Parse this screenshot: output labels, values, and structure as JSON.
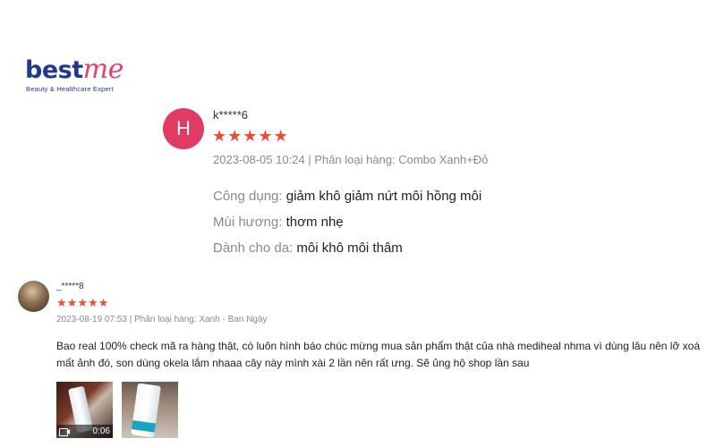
{
  "brand": {
    "name_part1": "best",
    "name_part2": "me",
    "tagline": "Beauty & Healthcare Expert",
    "primary_color": "#233a8c",
    "accent_color": "#e5406f"
  },
  "reviews": [
    {
      "avatar_initial": "H",
      "avatar_color": "#e23b63",
      "username": "k*****6",
      "rating": 5,
      "meta": "2023-08-05 10:24 | Phân loại hàng: Combo Xanh+Đỏ",
      "attributes": [
        {
          "label": "Công dụng:",
          "value": "giảm khô giảm nứt môi hồng môi"
        },
        {
          "label": "Mùi hương:",
          "value": "thơm nhẹ"
        },
        {
          "label": "Dành cho da:",
          "value": "môi khô môi thâm"
        }
      ]
    },
    {
      "avatar_icon": "user-photo",
      "username": "_*****8",
      "rating": 5,
      "meta": "2023-08-19 07:53 | Phân loại hàng: Xanh - Ban Ngày",
      "text": "Bao real 100% check mã ra hàng thật, có luôn hình báo chúc mừng mua sản phẩm thật của nhà mediheal nhma vì dùng lâu nên lỡ xoá mất ảnh đó, son dùng okela lắm nhaaa cây này mình xài 2 lần nên rất ưng. Sẽ ủng hộ shop lần sau",
      "media": {
        "video_duration": "0:06",
        "video_icon": "video-camera-icon"
      }
    }
  ],
  "star_color": "#ee4d2d",
  "star_glyph": "★"
}
